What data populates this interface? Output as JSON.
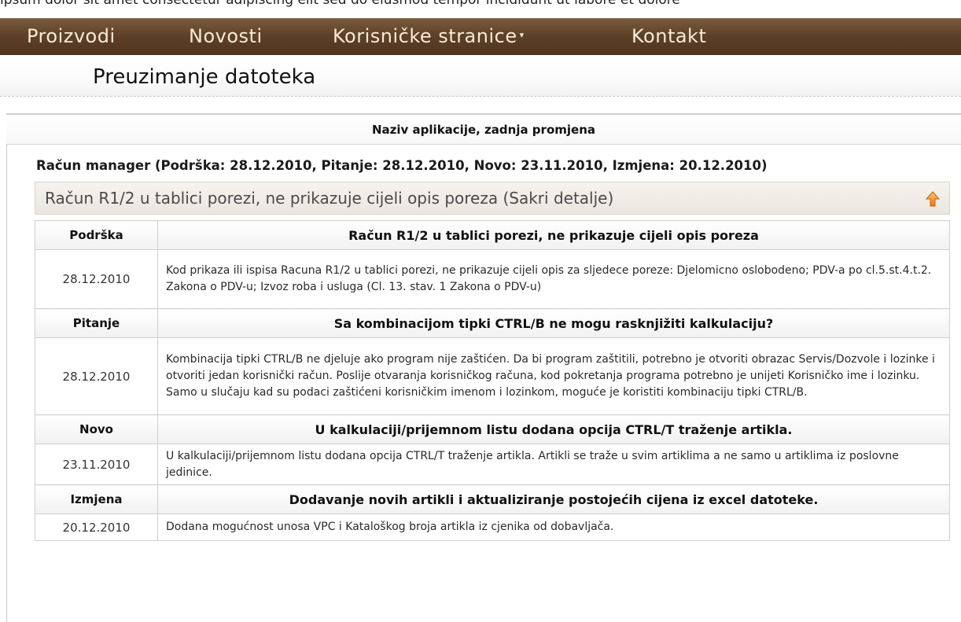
{
  "top_strip": {
    "text": "lpsum dolor sit amet consectetur adipiscing elit sed do eiusmod tempor incididunt ut labore et dolore"
  },
  "nav": {
    "items": [
      {
        "label": "Proizvodi"
      },
      {
        "label": "Novosti"
      },
      {
        "label": "Korisničke stranice",
        "has_dropdown": true
      },
      {
        "label": "Kontakt"
      }
    ],
    "dropdown_glyph": "▾"
  },
  "page": {
    "title": "Preuzimanje datoteka"
  },
  "table_header": {
    "label": "Naziv aplikacije, zadnja promjena"
  },
  "application": {
    "summary": "Račun manager (Podrška: 28.12.2010, Pitanje: 28.12.2010, Novo: 23.11.2010, Izmjena: 20.12.2010)",
    "detail_toggle": "Račun R1/2 u tablici porezi, ne prikazuje cijeli opis poreza (Sakri detalje)",
    "entries": [
      {
        "type": "Podrška",
        "title": "Račun R1/2 u tablici porezi, ne prikazuje cijeli opis poreza",
        "date": "28.12.2010",
        "description": "Kod prikaza ili ispisa Racuna R1/2 u tablici porezi, ne prikazuje cijeli opis za sljedece poreze: Djelomicno oslobodeno; PDV-a po cl.5.st.4.t.2. Zakona o PDV-u; Izvoz roba i usluga (Cl. 13. stav. 1 Zakona o PDV-u)"
      },
      {
        "type": "Pitanje",
        "title": "Sa kombinacijom tipki CTRL/B ne mogu rasknjižiti kalkulaciju?",
        "date": "28.12.2010",
        "description": "Kombinacija tipki CTRL/B ne djeluje ako program nije zaštićen. Da bi program zaštitili, potrebno je otvoriti obrazac Servis/Dozvole i lozinke i otvoriti jedan korisnički račun. Poslije otvaranja korisničkog računa, kod pokretanja programa potrebno je unijeti Korisničko ime i lozinku. Samo u slučaju kad su podaci zaštićeni korisničkim imenom i lozinkom, moguće je koristiti kombinaciju tipki CTRL/B."
      },
      {
        "type": "Novo",
        "title": "U kalkulaciji/prijemnom listu dodana opcija CTRL/T traženje artikla.",
        "date": "23.11.2010",
        "description": "U kalkulaciji/prijemnom listu dodana opcija CTRL/T traženje artikla. Artikli se traže u svim artiklima a ne samo u artiklima iz poslovne jedinice."
      },
      {
        "type": "Izmjena",
        "title": "Dodavanje novih artikli i aktualiziranje postojećih cijena iz excel datoteke.",
        "date": "20.12.2010",
        "description": "Dodana mogućnost unosa VPC i Kataloškog broja artikla iz cjenika od dobavljača."
      }
    ]
  },
  "colors": {
    "nav_bar": "#5f4128",
    "nav_text": "#f6ead8",
    "detail_bar": "#eae6df",
    "up_arrow": "#f08a1c",
    "table_border": "#cfcfcf"
  },
  "icons": {
    "collapse": "up-arrow-icon"
  }
}
